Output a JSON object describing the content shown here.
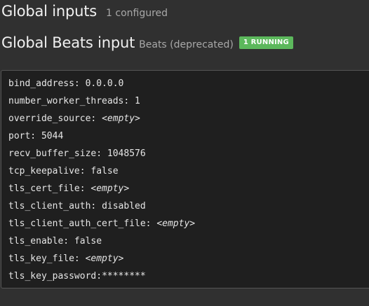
{
  "section": {
    "title": "Global inputs",
    "count": "1 configured"
  },
  "input": {
    "title": "Global Beats input",
    "type": "Beats (deprecated)",
    "status_badge": "1 RUNNING",
    "status_color": "#5cb85c"
  },
  "config": [
    {
      "key": "bind_address: ",
      "value": "0.0.0.0",
      "empty": false
    },
    {
      "key": "number_worker_threads: ",
      "value": "1",
      "empty": false
    },
    {
      "key": "override_source: ",
      "value": "<empty>",
      "empty": true
    },
    {
      "key": "port: ",
      "value": "5044",
      "empty": false
    },
    {
      "key": "recv_buffer_size: ",
      "value": "1048576",
      "empty": false
    },
    {
      "key": "tcp_keepalive: ",
      "value": "false",
      "empty": false
    },
    {
      "key": "tls_cert_file: ",
      "value": "<empty>",
      "empty": true
    },
    {
      "key": "tls_client_auth: ",
      "value": "disabled",
      "empty": false
    },
    {
      "key": "tls_client_auth_cert_file: ",
      "value": "<empty>",
      "empty": true
    },
    {
      "key": "tls_enable: ",
      "value": "false",
      "empty": false
    },
    {
      "key": "tls_key_file: ",
      "value": "<empty>",
      "empty": true
    },
    {
      "key": "tls_key_password:",
      "value": "********",
      "empty": false
    }
  ]
}
